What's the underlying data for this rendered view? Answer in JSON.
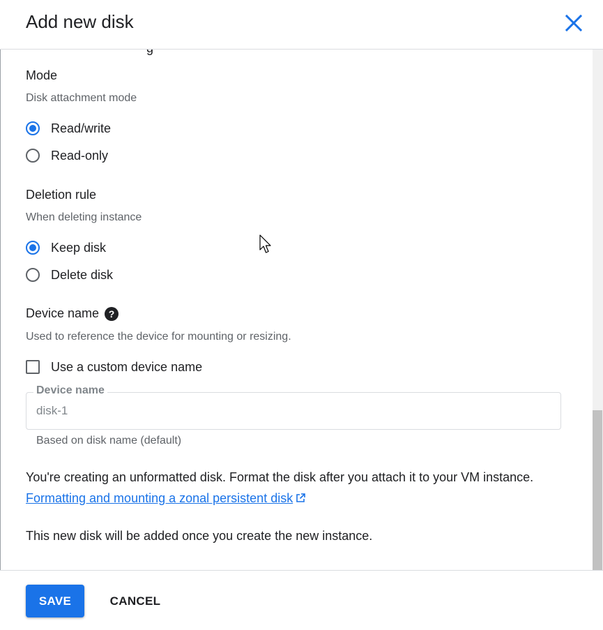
{
  "dialog": {
    "title": "Add new disk",
    "close_icon": "close-icon"
  },
  "colors": {
    "accent": "#1a73e8",
    "text": "#202124",
    "helper": "#5f6368"
  },
  "mode": {
    "title": "Mode",
    "helper": "Disk attachment mode",
    "options": [
      {
        "label": "Read/write",
        "selected": true
      },
      {
        "label": "Read-only",
        "selected": false
      }
    ]
  },
  "deletion": {
    "title": "Deletion rule",
    "helper": "When deleting instance",
    "options": [
      {
        "label": "Keep disk",
        "selected": true
      },
      {
        "label": "Delete disk",
        "selected": false
      }
    ]
  },
  "device": {
    "title": "Device name",
    "help_icon": "help-icon",
    "helper": "Used to reference the device for mounting or resizing.",
    "checkbox_label": "Use a custom device name",
    "checkbox_checked": false,
    "field_label": "Device name",
    "field_value": "disk-1",
    "field_hint": "Based on disk name (default)"
  },
  "notice": {
    "text": "You're creating an unformatted disk. Format the disk after you attach it to your VM instance.",
    "link": "Formatting and mounting a zonal persistent disk",
    "link_icon": "external-link-icon",
    "footer_text": "This new disk will be added once you create the new instance."
  },
  "actions": {
    "save": "SAVE",
    "cancel": "CANCEL"
  }
}
